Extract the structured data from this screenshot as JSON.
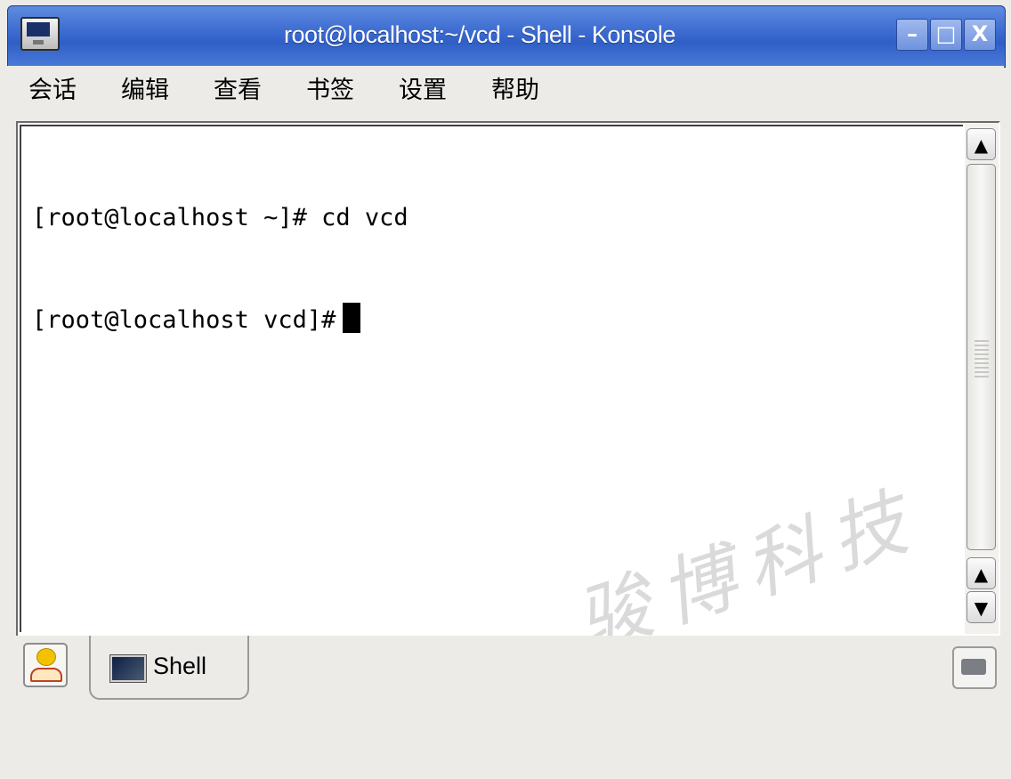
{
  "window": {
    "title": "root@localhost:~/vcd - Shell - Konsole",
    "app_icon": "terminal-monitor-icon",
    "controls": {
      "minimize_label": "–",
      "maximize_label": "□",
      "close_label": "X"
    }
  },
  "menubar": {
    "items": [
      {
        "label": "会话"
      },
      {
        "label": "编辑"
      },
      {
        "label": "查看"
      },
      {
        "label": "书签"
      },
      {
        "label": "设置"
      },
      {
        "label": "帮助"
      }
    ]
  },
  "terminal": {
    "lines": [
      "[root@localhost ~]# cd vcd",
      "[root@localhost vcd]#"
    ]
  },
  "scrollbar": {
    "up_label": "▲",
    "down_label": "▼",
    "page_up_label": "▲"
  },
  "watermark": {
    "text": "骏博科技"
  },
  "tabs": {
    "new_session_icon": "new-session-icon",
    "items": [
      {
        "label": "Shell",
        "icon": "terminal-icon",
        "active": true
      }
    ],
    "close_session_icon": "close-session-icon"
  },
  "colors": {
    "titlebar": "#3a69cf",
    "background": "#ecebe8",
    "terminal_bg": "#ffffff",
    "terminal_fg": "#000000"
  }
}
